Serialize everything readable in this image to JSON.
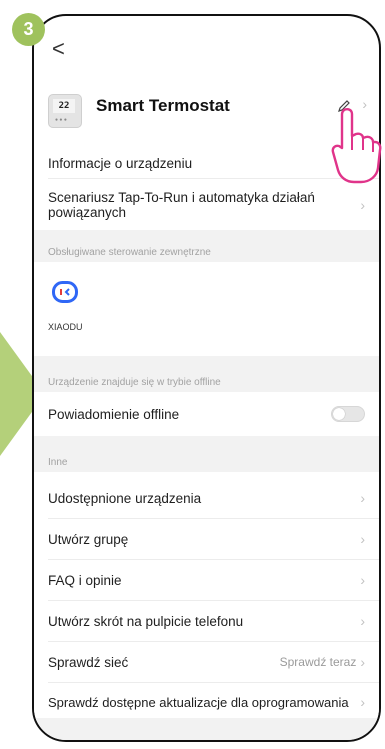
{
  "step": {
    "number": "3"
  },
  "nav": {
    "back_glyph": "<"
  },
  "device": {
    "name": "Smart Termostat",
    "display": "22"
  },
  "rows": {
    "info": "Informacje o urządzeniu",
    "scenes": "Scenariusz Tap-To-Run i automatyka działań powiązanych"
  },
  "sections": {
    "external": "Obsługiwane sterowanie zewnętrzne",
    "offline": "Urządzenie znajduje się w trybie offline",
    "other": "Inne"
  },
  "external": {
    "items": [
      {
        "label": "XIAODU",
        "icon": "xiaodu-logo",
        "color": "#2f67f6"
      }
    ]
  },
  "offline": {
    "label": "Powiadomienie offline",
    "enabled": false
  },
  "menu": {
    "items": [
      {
        "label": "Udostępnione urządzenia"
      },
      {
        "label": "Utwórz grupę"
      },
      {
        "label": "FAQ i opinie"
      },
      {
        "label": "Utwórz skrót na pulpicie telefonu"
      },
      {
        "label": "Sprawdź sieć",
        "value": "Sprawdź teraz"
      },
      {
        "label": "Sprawdź dostępne aktualizacje dla oprogramowania"
      }
    ]
  },
  "colors": {
    "accent_green": "#9fc25d",
    "hand_pink": "#e0348a"
  }
}
